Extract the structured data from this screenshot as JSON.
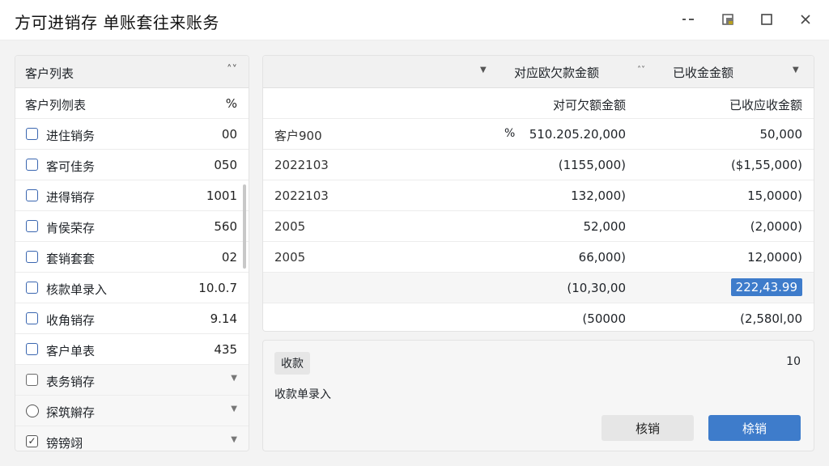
{
  "window": {
    "title": "方可进销存   单账套往来账务",
    "controls": {
      "minimize": "-·",
      "restore": "▣",
      "maximize": "☐",
      "close": "✕"
    }
  },
  "left_panel": {
    "header": "客户列表",
    "header_icon": "˄˅",
    "column_header": {
      "name": "客户列刎表",
      "value": "%"
    },
    "items": [
      {
        "name": "进住销务",
        "value": "00",
        "control": "checkbox",
        "checked": false
      },
      {
        "name": "客可佳务",
        "value": "050",
        "control": "checkbox",
        "checked": false
      },
      {
        "name": "进得销存",
        "value": "1001",
        "control": "checkbox",
        "checked": false
      },
      {
        "name": "肯侯荣存",
        "value": "560",
        "control": "checkbox",
        "checked": false
      },
      {
        "name": "套销套套",
        "value": "02",
        "control": "checkbox",
        "checked": false
      },
      {
        "name": "核款单录入",
        "value": "10.0.7",
        "control": "checkbox",
        "checked": false
      },
      {
        "name": "收角销存",
        "value": "9.14",
        "control": "checkbox",
        "checked": false
      },
      {
        "name": "客户单表",
        "value": "435",
        "control": "checkbox",
        "checked": false
      }
    ],
    "extra_items": [
      {
        "name": "表务销存",
        "control": "checkbox",
        "checked": false
      },
      {
        "name": "探筑辮存",
        "control": "radio",
        "checked": false
      },
      {
        "name": "镑镑翊",
        "control": "checkbox",
        "checked": true
      }
    ]
  },
  "right_panel": {
    "header": {
      "col2": "对应欧欠款金额",
      "col3": "已收金金额"
    },
    "subheader": {
      "col2": "对可欠额金额",
      "col3": "已收应收金额"
    },
    "rows": [
      {
        "c1": "客户900",
        "pct": "%",
        "c2": "510.205.20,000",
        "c3": "50,000",
        "highlight": false,
        "shaded": false
      },
      {
        "c1": "2022103",
        "pct": "",
        "c2": "(1155,000)",
        "c3": "($1,55,000)",
        "highlight": false,
        "shaded": false
      },
      {
        "c1": "2022103",
        "pct": "",
        "c2": "132,000)",
        "c3": "15,0000)",
        "highlight": false,
        "shaded": false
      },
      {
        "c1": "2005",
        "pct": "",
        "c2": "52,000",
        "c3": "(2,0000)",
        "highlight": false,
        "shaded": false
      },
      {
        "c1": "2005",
        "pct": "",
        "c2": "66,000)",
        "c3": "12,0000)",
        "highlight": false,
        "shaded": false
      },
      {
        "c1": "",
        "pct": "",
        "c2": "(10,30,00",
        "c3": "222,43.99",
        "highlight": true,
        "shaded": true
      },
      {
        "c1": "",
        "pct": "",
        "c2": "(50000",
        "c3": "(2,580l,00",
        "highlight": false,
        "shaded": false
      }
    ]
  },
  "form": {
    "tag": "收款",
    "number": "10",
    "label": "收款单录入",
    "button_secondary": "核销",
    "button_primary": "梌销"
  },
  "colors": {
    "accent": "#3e7ccb",
    "checkbox": "#3a66b0"
  }
}
